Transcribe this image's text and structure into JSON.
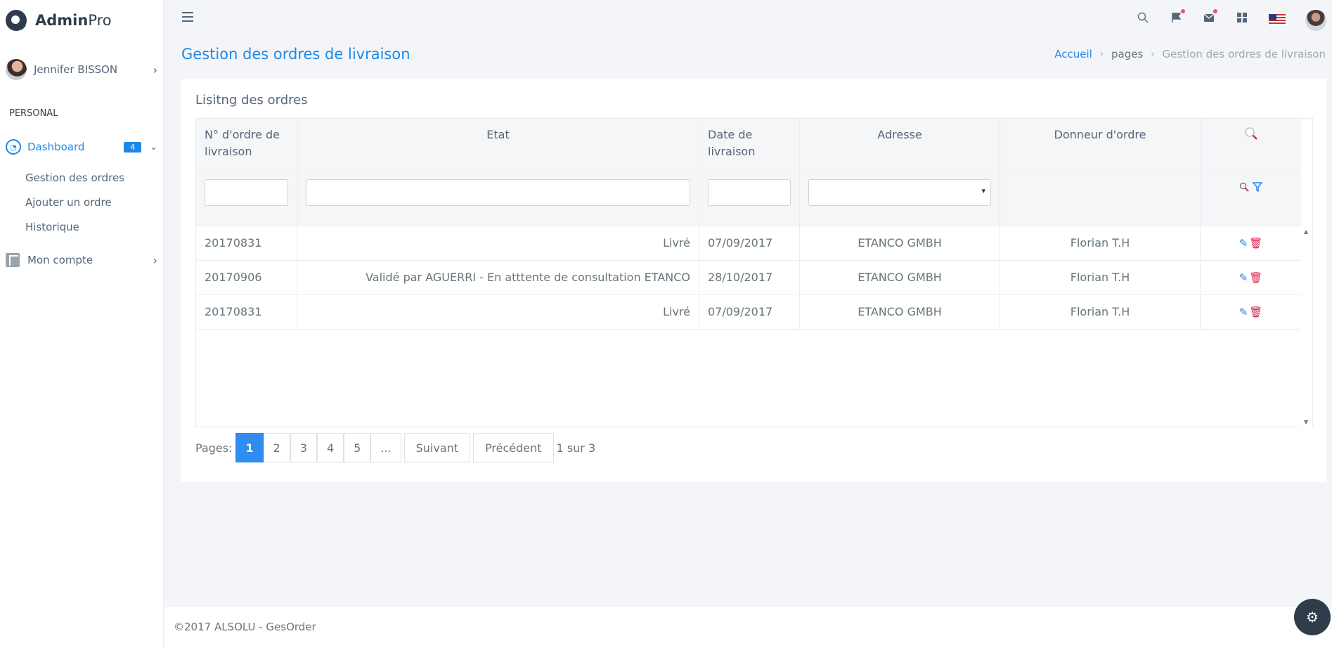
{
  "app": {
    "brand_bold": "Admin",
    "brand_light": "Pro"
  },
  "sidebar": {
    "user_name": "Jennifer BISSON",
    "section": "PERSONAL",
    "dashboard": {
      "label": "Dashboard",
      "badge": "4"
    },
    "sub_items": [
      "Gestion des ordres",
      "Ajouter un ordre",
      "Historique"
    ],
    "account": "Mon compte"
  },
  "header": {
    "icons": [
      "search-icon",
      "flag-icon",
      "mail-icon",
      "grid-icon"
    ],
    "language": "en-US"
  },
  "page": {
    "title": "Gestion des ordres de livraison",
    "breadcrumb": [
      "Accueil",
      "pages",
      "Gestion des ordres de livraison"
    ]
  },
  "card": {
    "title": "Lisitng des ordres",
    "columns": [
      "N° d'ordre de livraison",
      "Etat",
      "Date de livraison",
      "Adresse",
      "Donneur d'ordre"
    ],
    "rows": [
      [
        "20170831",
        "Livré",
        "07/09/2017",
        "ETANCO GMBH",
        "Florian T.H"
      ],
      [
        "20170906",
        "Validé par AGUERRI - En atttente de consultation ETANCO",
        "28/10/2017",
        "ETANCO GMBH",
        "Florian T.H"
      ],
      [
        "20170831",
        "Livré",
        "07/09/2017",
        "ETANCO GMBH",
        "Florian T.H"
      ]
    ]
  },
  "pager": {
    "label": "Pages:",
    "pages": [
      "1",
      "2",
      "3",
      "4",
      "5",
      "..."
    ],
    "next": "Suivant",
    "prev": "Précédent",
    "info": "1 sur 3"
  },
  "footer": {
    "text": "©2017 ALSOLU - GesOrder"
  }
}
